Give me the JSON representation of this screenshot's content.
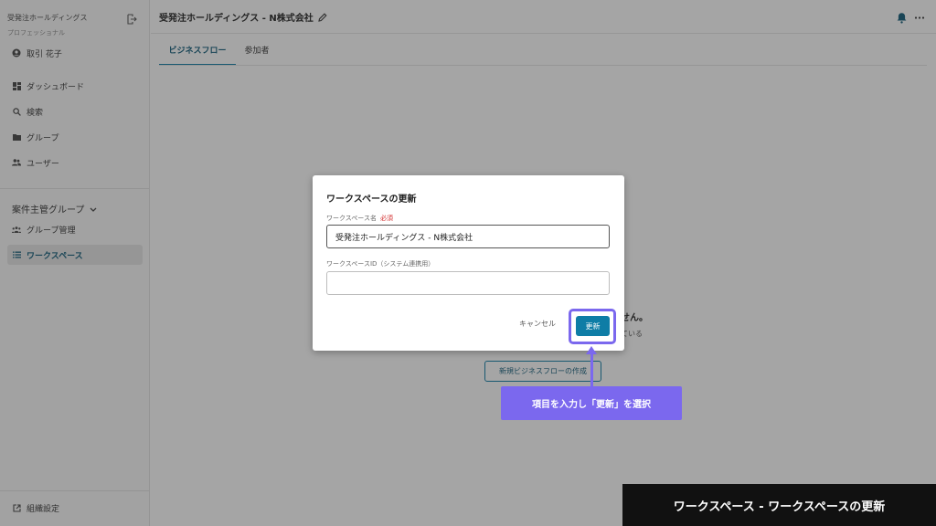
{
  "sidebar": {
    "org_name": "受発注ホールディングス",
    "plan": "プロフェッショナル",
    "user": "取引 花子",
    "items": [
      {
        "label": "ダッシュボード",
        "icon": "dashboard-icon"
      },
      {
        "label": "検索",
        "icon": "search-icon"
      },
      {
        "label": "グループ",
        "icon": "folder-icon"
      },
      {
        "label": "ユーザー",
        "icon": "users-icon"
      }
    ],
    "group_section": "案件主管グループ",
    "group_items": [
      {
        "label": "グループ管理",
        "icon": "group-icon"
      },
      {
        "label": "ワークスペース",
        "icon": "list-icon",
        "active": true
      }
    ],
    "settings": "組織設定"
  },
  "header": {
    "title": "受発注ホールディングス - N株式会社"
  },
  "tabs": [
    {
      "label": "ビジネスフロー",
      "active": true
    },
    {
      "label": "参加者",
      "active": false
    }
  ],
  "empty_state": {
    "title_fragment": "せん。",
    "sub_fragment": "ている",
    "create_button": "新規ビジネスフローの作成"
  },
  "modal": {
    "title": "ワークスペースの更新",
    "name_label": "ワークスペース名",
    "required_label": "必須",
    "name_value": "受発注ホールディングス - N株式会社",
    "id_label": "ワークスペースID（システム連携用）",
    "id_value": "",
    "cancel_label": "キャンセル",
    "update_label": "更新"
  },
  "annotation": {
    "callout": "項目を入力し「更新」を選択",
    "caption": "ワークスペース - ワークスペースの更新"
  },
  "colors": {
    "accent": "#0e7da6",
    "highlight": "#7b68ee",
    "required": "#d32f2f"
  }
}
